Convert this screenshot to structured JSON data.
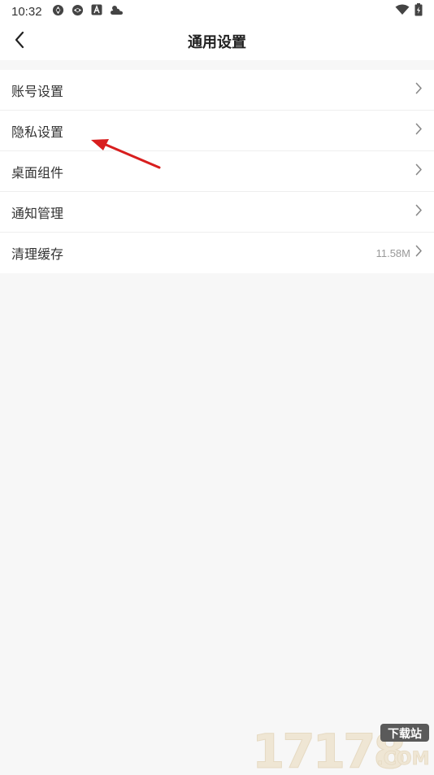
{
  "status_bar": {
    "time": "10:32",
    "icons": [
      "camera-shutter-icon",
      "camera-shutter-icon",
      "a-badge-icon",
      "weather-icon"
    ],
    "right_icons": [
      "wifi-icon",
      "battery-icon"
    ]
  },
  "header": {
    "title": "通用设置",
    "back_icon": "chevron-left-icon"
  },
  "settings": [
    {
      "label": "账号设置",
      "value": ""
    },
    {
      "label": "隐私设置",
      "value": ""
    },
    {
      "label": "桌面组件",
      "value": ""
    },
    {
      "label": "通知管理",
      "value": ""
    },
    {
      "label": "清理缓存",
      "value": "11.58M"
    }
  ],
  "watermark": {
    "text": "17178",
    "suffix": ".COM",
    "badge": "下载站"
  },
  "colors": {
    "background": "#f7f7f7",
    "surface": "#ffffff",
    "annotation_arrow": "#d81e1e",
    "watermark": "#efe6d4"
  }
}
